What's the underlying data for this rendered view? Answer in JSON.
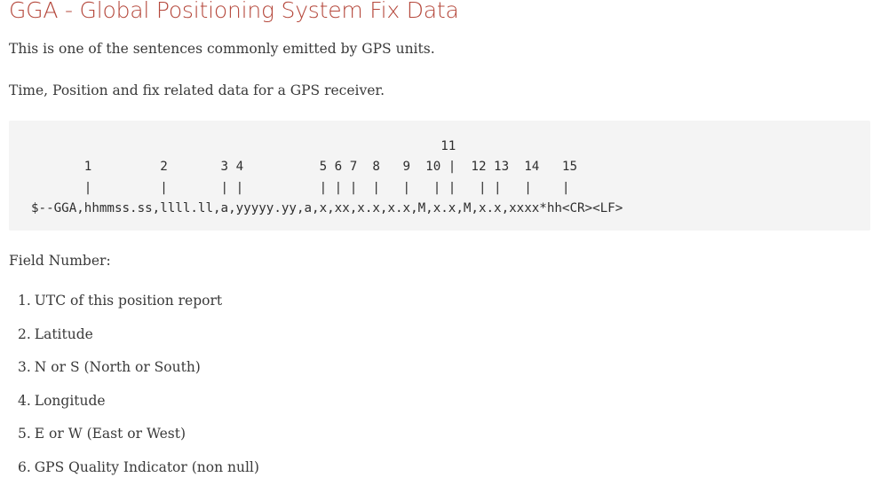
{
  "page": {
    "title": "GGA - Global Positioning System Fix Data",
    "intro_1": "This is one of the sentences commonly emitted by GPS units.",
    "intro_2": "Time, Position and fix related data for a GPS receiver.",
    "code_lines": [
      "                                                      11",
      "       1         2       3 4          5 6 7  8   9  10 |  12 13  14   15",
      "       |         |       | |          | | |  |   |   | |   | |   |    |",
      "$--GGA,hhmmss.ss,llll.ll,a,yyyyy.yy,a,x,xx,x.x,x.x,M,x.x,M,x.x,xxxx*hh<CR><LF>"
    ],
    "field_heading": "Field Number:",
    "fields": [
      {
        "num": "1.",
        "text": "UTC of this position report"
      },
      {
        "num": "2.",
        "text": "Latitude"
      },
      {
        "num": "3.",
        "text": "N or S (North or South)"
      },
      {
        "num": "4.",
        "text": "Longitude"
      },
      {
        "num": "5.",
        "text": "E or W (East or West)"
      },
      {
        "num": "6.",
        "text": "GPS Quality Indicator (non null)"
      }
    ]
  }
}
